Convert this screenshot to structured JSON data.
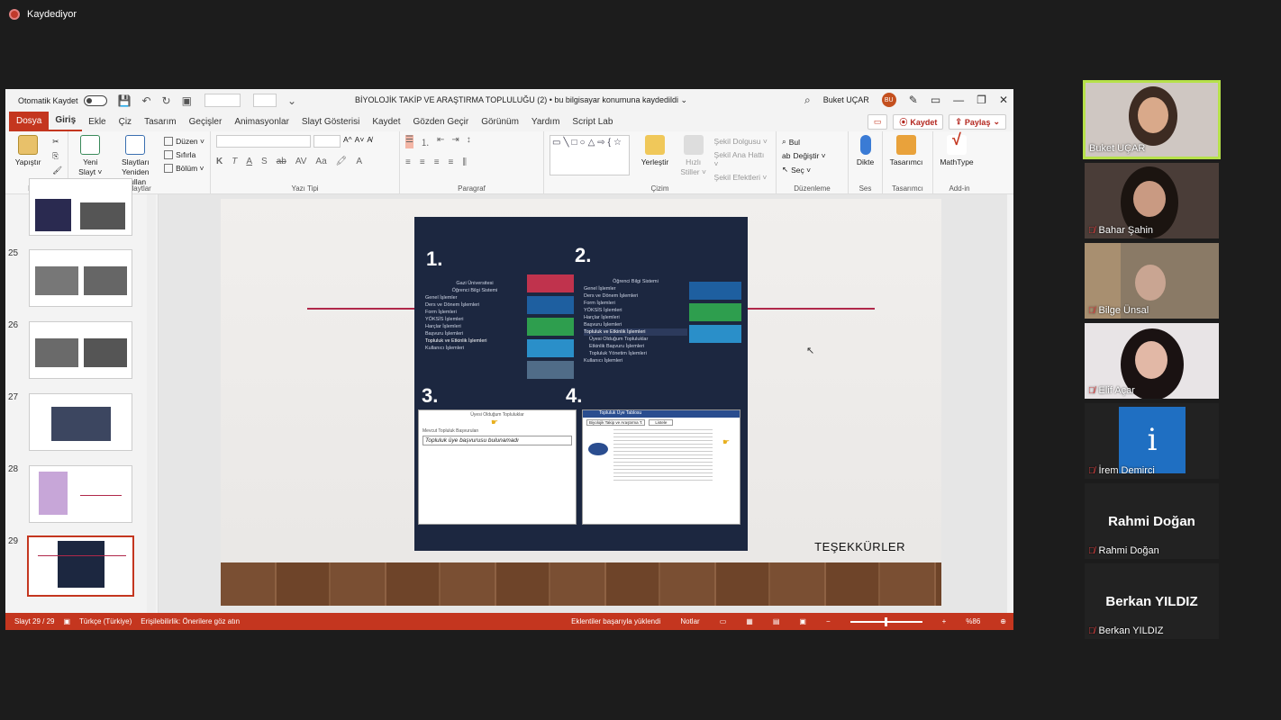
{
  "recording": {
    "label": "Kaydediyor"
  },
  "ppt": {
    "autosave_label": "Otomatik Kaydet",
    "document_title": "BİYOLOJİK TAKİP VE ARAŞTIRMA TOPLULUĞU (2)  •  bu bilgisayar konumuna kaydedildi  ⌄",
    "user_name": "Buket UÇAR",
    "user_initials": "BU",
    "menu_tabs": [
      "Dosya",
      "Giriş",
      "Ekle",
      "Çiz",
      "Tasarım",
      "Geçişler",
      "Animasyonlar",
      "Slayt Gösterisi",
      "Kaydet",
      "Gözden Geçir",
      "Görünüm",
      "Yardım",
      "Script Lab"
    ],
    "save_button": "Kaydet",
    "share_button": "Paylaş",
    "ribbon": {
      "paste": "Yapıştır",
      "new_slide_1": "Yeni",
      "new_slide_2": "Slayt ˅",
      "reuse_1": "Slaytları",
      "reuse_2": "Yeniden Kullan",
      "layout": "Düzen ˅",
      "reset": "Sıfırla",
      "section": "Bölüm ˅",
      "arrange": "Yerleştir",
      "quick_styles_1": "Hızlı",
      "quick_styles_2": "Stiller ˅",
      "shape_fill": "Şekil Dolgusu ˅",
      "shape_outline": "Şekil Ana Hattı ˅",
      "shape_effects": "Şekil Efektleri ˅",
      "find": "Bul",
      "replace": "Değiştir  ˅",
      "select": "Seç ˅",
      "dictate": "Dikte",
      "designer": "Tasarımcı",
      "mathtype": "MathType",
      "groups": {
        "clipboard": "Pano",
        "slides": "Slaytlar",
        "font": "Yazı Tipi",
        "paragraph": "Paragraf",
        "drawing": "Çizim",
        "editing": "Düzenleme",
        "voice": "Ses",
        "designer": "Tasarımcı",
        "addin": "Add-in"
      }
    },
    "slide_numbers": [
      "25",
      "26",
      "27",
      "28",
      "29"
    ],
    "slide": {
      "steps": [
        "1.",
        "2.",
        "3.",
        "4."
      ],
      "thanks": "TEŞEKKÜRLER",
      "step1_title": "Gazi Üniversitesi",
      "step1_sub": "Öğrenci Bilgi Sistemi",
      "step1_items": [
        "Genel İşlemler",
        "Ders ve Dönem İşlemleri",
        "Form İşlemleri",
        "YÖKSİS İşlemleri",
        "Harçlar İşlemleri",
        "Başvuru İşlemleri",
        "Topluluk ve Etkinlik İşlemleri",
        "Kullanıcı İşlemleri"
      ],
      "step2_title": "Öğrenci Bilgi Sistemi",
      "step2_items": [
        "Genel İşlemler",
        "Ders ve Dönem İşlemleri",
        "Form İşlemleri",
        "YÖKSİS İşlemleri",
        "Harçlar İşlemleri",
        "Başvuru İşlemleri",
        "Topluluk ve Etkinlik İşlemleri",
        "Üyesi Olduğum Topluluklar",
        "Etkinlik Başvuru İşlemleri",
        "Topluluk Yönetim İşlemleri",
        "Kullanıcı İşlemleri"
      ],
      "step3_title": "Üyesi Olduğum Topluluklar",
      "step3_label": "Mevcut Topluluk Başvuruları",
      "step3_message": "Topluluk üye başvurusu bulunamadı",
      "step4_title": "Topluluk Üye Tablosu",
      "step4_field": "Biyolojik Takip ve Araştırma T.",
      "step4_btn": "Listele"
    },
    "status": {
      "slide": "Slayt 29 / 29",
      "lang": "Türkçe (Türkiye)",
      "access": "Erişilebilirlik: Önerilere göz atın",
      "addins": "Eklentiler başarıyla yüklendi",
      "notes": "Notlar",
      "zoom": "%86"
    }
  },
  "participants": [
    {
      "name": "Buket UÇAR",
      "muted": false,
      "active": true,
      "video": true
    },
    {
      "name": "Bahar Şahin",
      "muted": true,
      "active": false,
      "video": true
    },
    {
      "name": "Bilge Ünsal",
      "muted": true,
      "active": false,
      "video": true
    },
    {
      "name": "Elif Açar",
      "muted": true,
      "active": false,
      "video": true
    },
    {
      "name": "İrem Demirci",
      "muted": true,
      "active": false,
      "video": false
    },
    {
      "name": "Rahmi Doğan",
      "muted": true,
      "active": false,
      "video": false
    },
    {
      "name": "Berkan YILDIZ",
      "muted": true,
      "active": false,
      "video": false
    }
  ],
  "colors": {
    "accent": "#c4361f",
    "active_speaker": "#b6e14a",
    "slide_panel": "#1c2740"
  }
}
